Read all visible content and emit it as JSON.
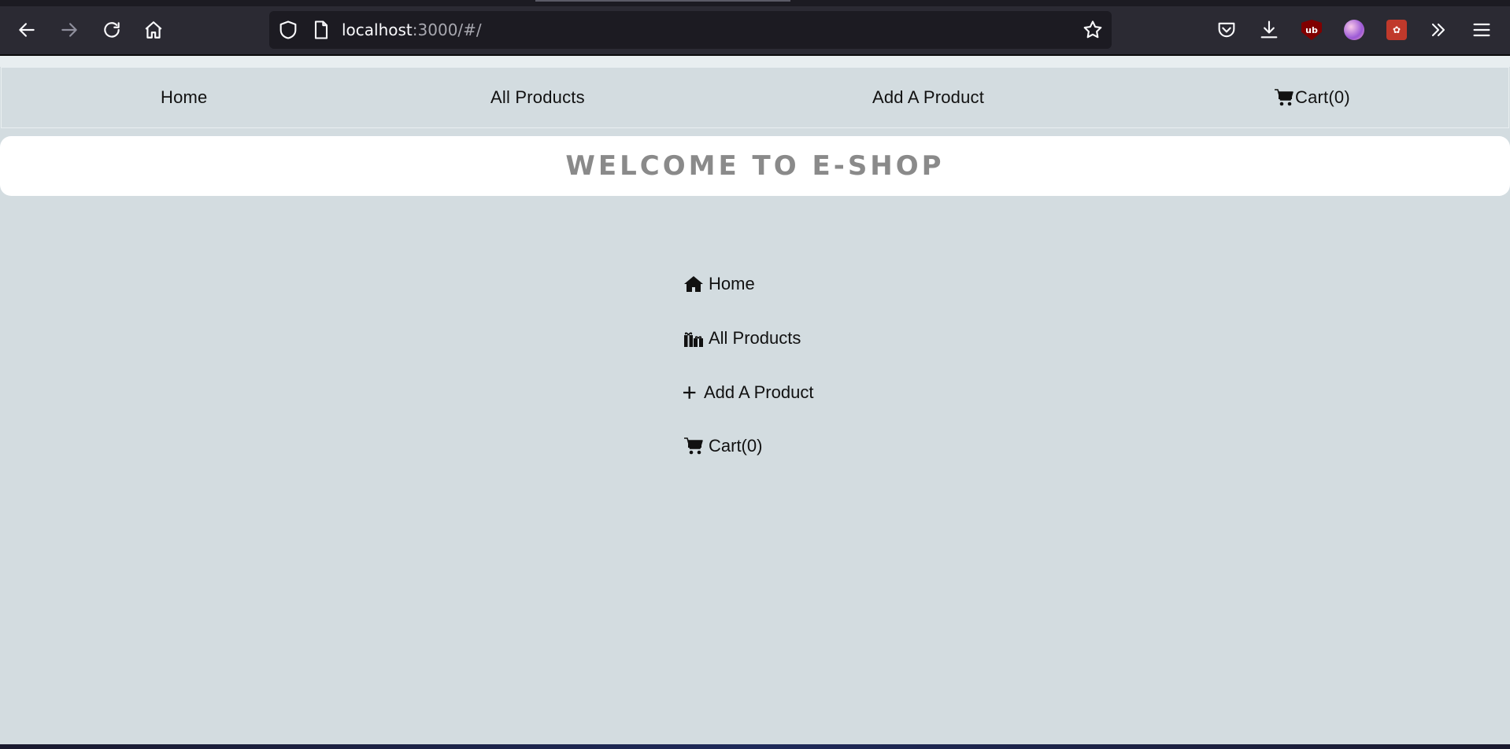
{
  "browser": {
    "url_host": "localhost",
    "url_rest": ":3000/#/",
    "icons": {
      "back": "arrow-left-icon",
      "forward": "arrow-right-icon",
      "reload": "reload-icon",
      "home": "home-icon",
      "shield": "shield-icon",
      "page": "page-icon",
      "bookmark": "star-icon",
      "pocket": "pocket-icon",
      "downloads": "download-icon",
      "extensions": [
        "ublock-icon",
        "media-extension-icon",
        "red-extension-icon"
      ],
      "overflow": "chevrons-right-icon",
      "menu": "hamburger-menu-icon"
    },
    "ublock_label": "ub"
  },
  "topnav": {
    "items": [
      {
        "label": "Home"
      },
      {
        "label": "All Products"
      },
      {
        "label": "Add A Product"
      },
      {
        "label": "Cart(0)"
      }
    ]
  },
  "welcome": {
    "title": "WELCOME TO E-SHOP"
  },
  "menu": {
    "items": [
      {
        "label": "Home",
        "icon": "home-icon"
      },
      {
        "label": "All Products",
        "icon": "gifts-icon"
      },
      {
        "label": "Add A Product",
        "icon": "plus-icon"
      },
      {
        "label": "Cart(0)",
        "icon": "cart-icon"
      }
    ]
  },
  "colors": {
    "page_bg": "#d3dce0",
    "chrome_bg": "#2b2a33",
    "welcome_text": "#8a8a8a"
  }
}
